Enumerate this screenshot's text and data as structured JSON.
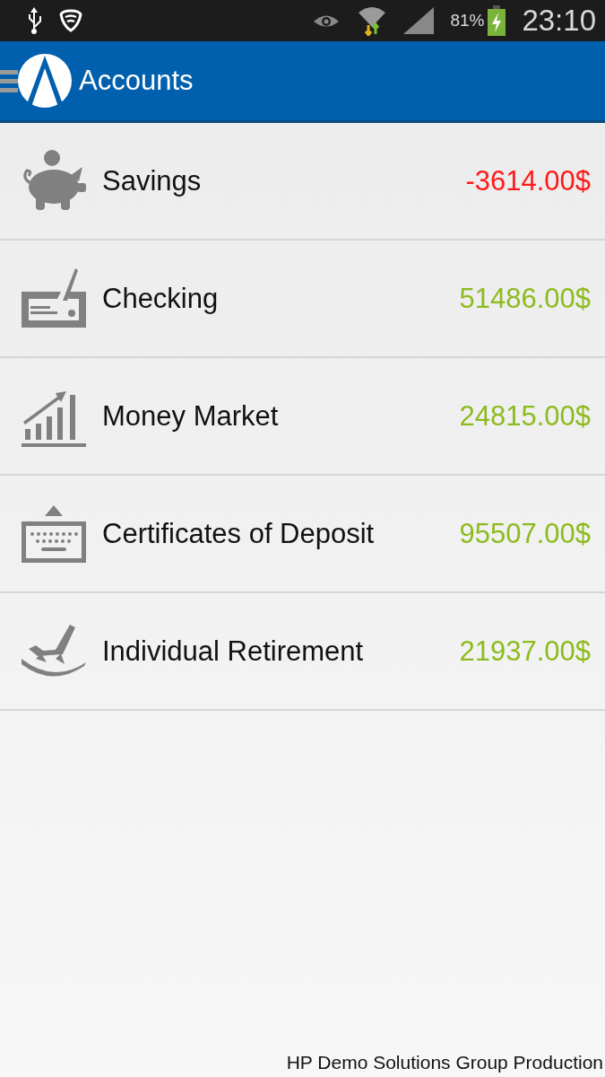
{
  "status_bar": {
    "battery": "81%",
    "time": "23:10"
  },
  "app_bar": {
    "title": "Accounts"
  },
  "accounts": [
    {
      "kind": "piggy",
      "name": "Savings",
      "amount": "-3614.00$",
      "color": "#ff1a1a"
    },
    {
      "kind": "check",
      "name": "Checking",
      "amount": "51486.00$",
      "color": "#8cbb1e"
    },
    {
      "kind": "chart",
      "name": "Money Market",
      "amount": "24815.00$",
      "color": "#8cbb1e"
    },
    {
      "kind": "keyboard",
      "name": "Certificates of Deposit",
      "amount": "95507.00$",
      "color": "#8cbb1e"
    },
    {
      "kind": "rocker",
      "name": "Individual Retirement",
      "amount": "21937.00$",
      "color": "#8cbb1e"
    }
  ],
  "footer": "HP Demo Solutions Group Production"
}
